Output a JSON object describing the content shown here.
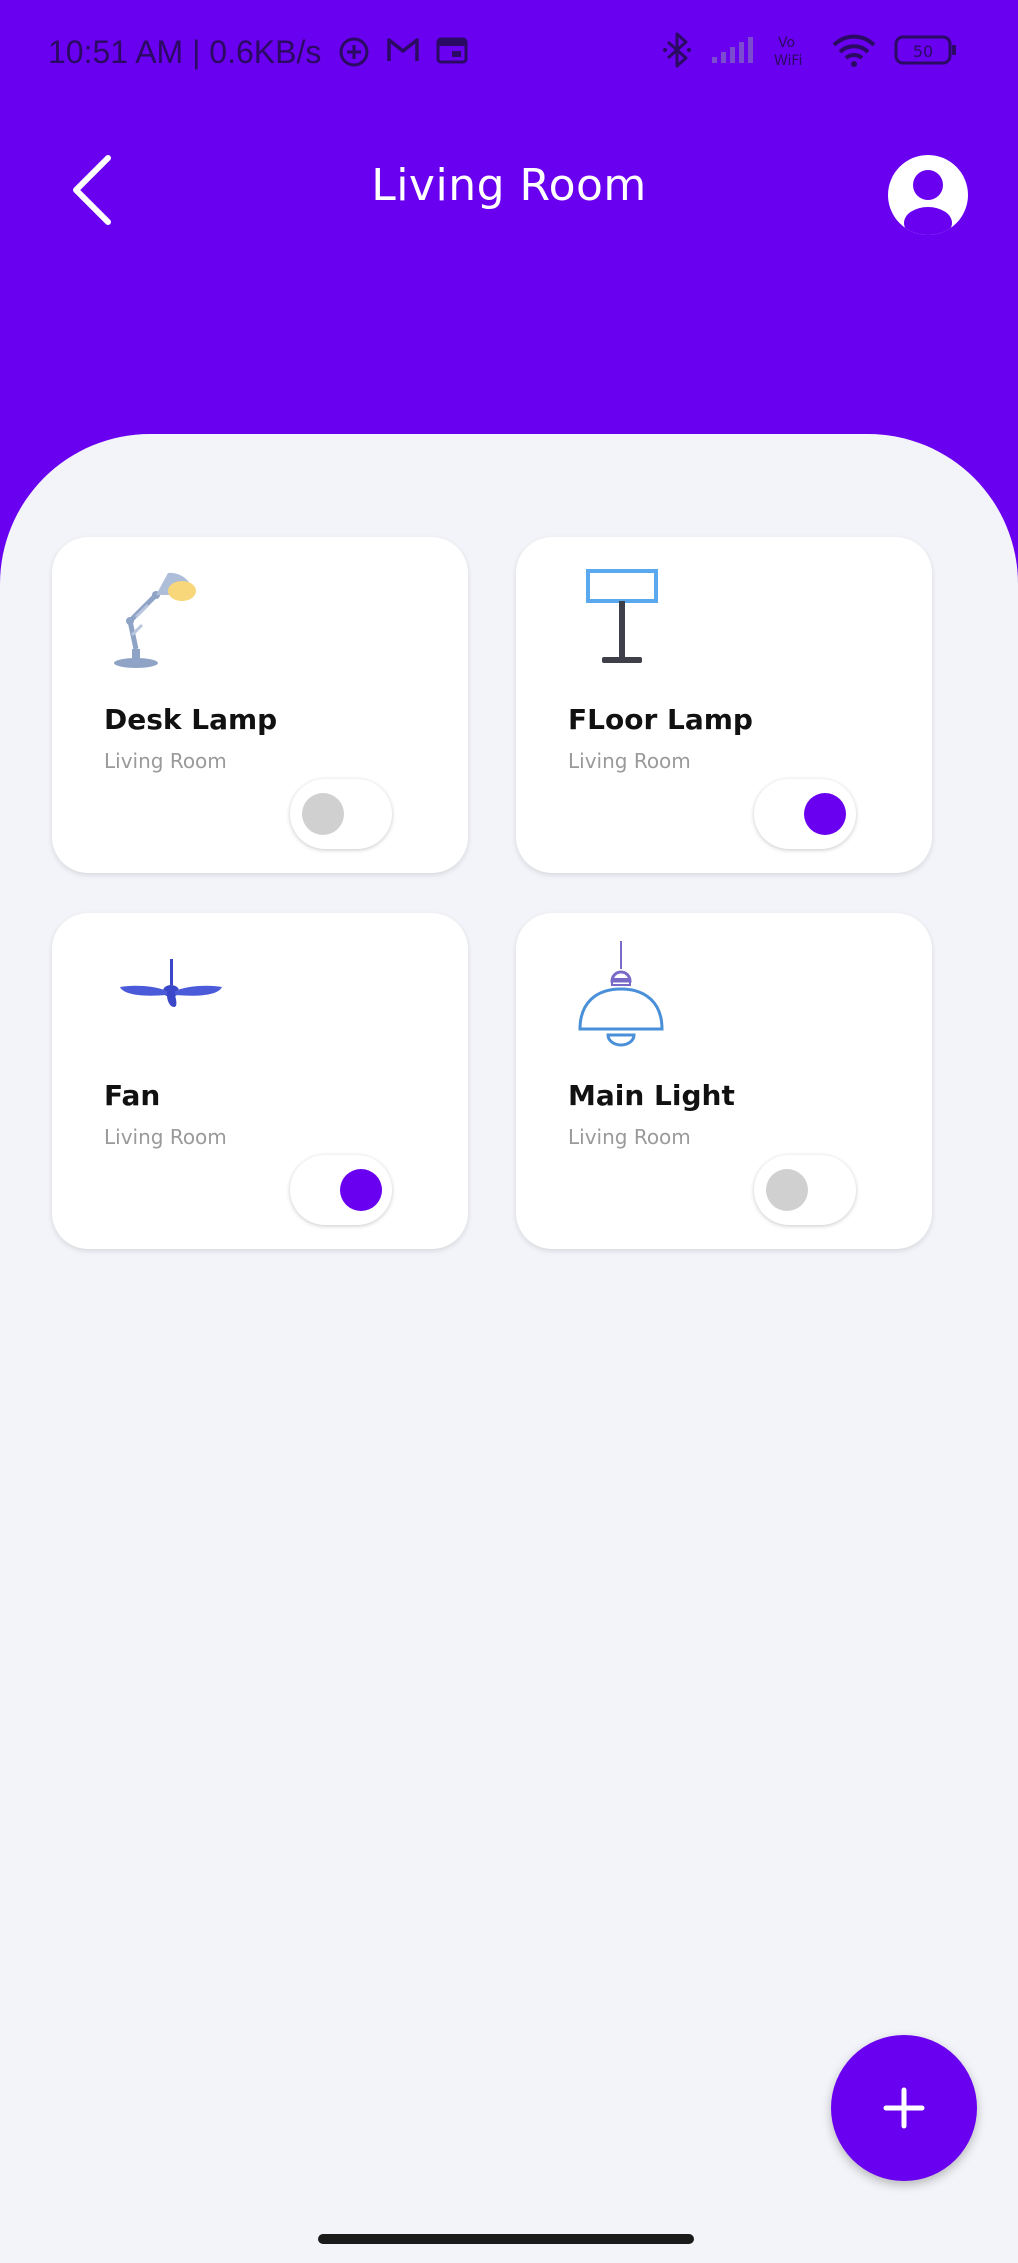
{
  "status_bar": {
    "time": "10:51 AM | 0.6KB/s",
    "icons": [
      "add-circle-icon",
      "gmail-icon",
      "calendar-icon",
      "bluetooth-icon",
      "signal-icon",
      "vowifi-icon",
      "wifi-icon",
      "battery-icon"
    ],
    "vowifi_label": "Vo WiFi",
    "battery_level": "50"
  },
  "header": {
    "title": "Living Room",
    "background_color": "#6a00f0"
  },
  "devices": [
    {
      "name": "Desk Lamp",
      "room": "Living Room",
      "icon": "desk-lamp-icon",
      "on": false
    },
    {
      "name": "FLoor Lamp",
      "room": "Living Room",
      "icon": "floor-lamp-icon",
      "on": true
    },
    {
      "name": "Fan",
      "room": "Living Room",
      "icon": "fan-icon",
      "on": true
    },
    {
      "name": "Main Light",
      "room": "Living Room",
      "icon": "pendant-light-icon",
      "on": false
    }
  ],
  "fab": {
    "icon": "plus-icon"
  },
  "colors": {
    "accent": "#6a00f0",
    "toggle_off": "#d0d0d0",
    "background": "#f3f4f9"
  }
}
